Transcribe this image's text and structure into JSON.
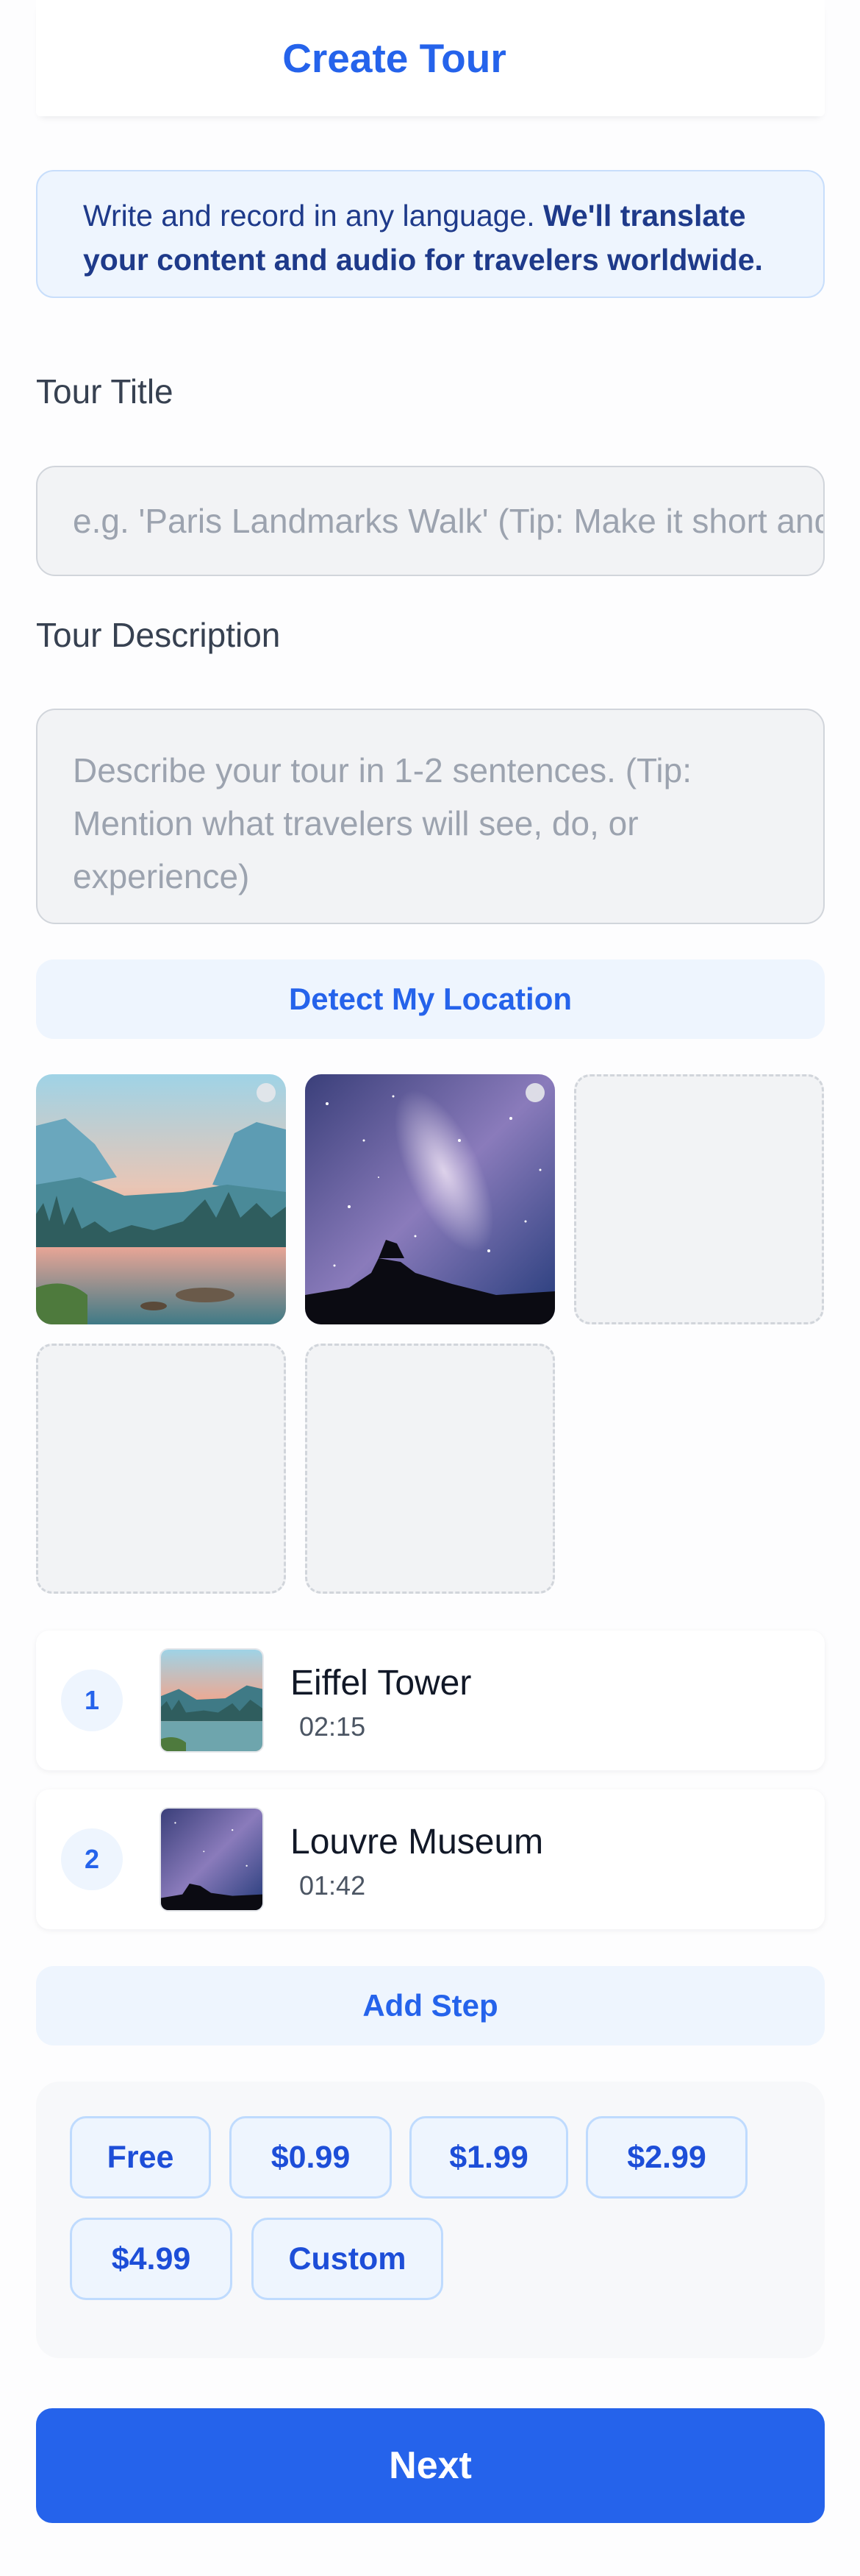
{
  "header": {
    "title": "Create Tour"
  },
  "banner": {
    "text_regular": "Write and record in any language. ",
    "text_bold": "We'll translate your content and audio for travelers worldwide."
  },
  "form": {
    "title_label": "Tour Title",
    "title_placeholder": "e.g. 'Paris Landmarks Walk' (Tip: Make it short and catchy)",
    "description_label": "Tour Description",
    "description_placeholder": "Describe your tour in 1-2 sentences. (Tip: Mention what travelers will see, do, or experience)"
  },
  "location_button": "Detect My Location",
  "photos": [
    {
      "image": "mountain-lake-sunset"
    },
    {
      "image": "milky-way-night-sky"
    },
    {
      "image": "empty-slot"
    },
    {
      "image": "empty-slot"
    },
    {
      "image": "empty-slot"
    }
  ],
  "steps": [
    {
      "number": "1",
      "name": "Eiffel Tower",
      "duration": "02:15",
      "image": "mountain-lake-sunset"
    },
    {
      "number": "2",
      "name": "Louvre Museum",
      "duration": "01:42",
      "image": "milky-way-night-sky"
    }
  ],
  "add_step_button": "Add Step",
  "pricing": {
    "options": [
      "Free",
      "$0.99",
      "$1.99",
      "$2.99",
      "$4.99",
      "Custom"
    ]
  },
  "next_button": "Next",
  "colors": {
    "accent": "#2563eb",
    "banner_bg": "#eef5fe",
    "input_bg": "#f2f3f5"
  }
}
